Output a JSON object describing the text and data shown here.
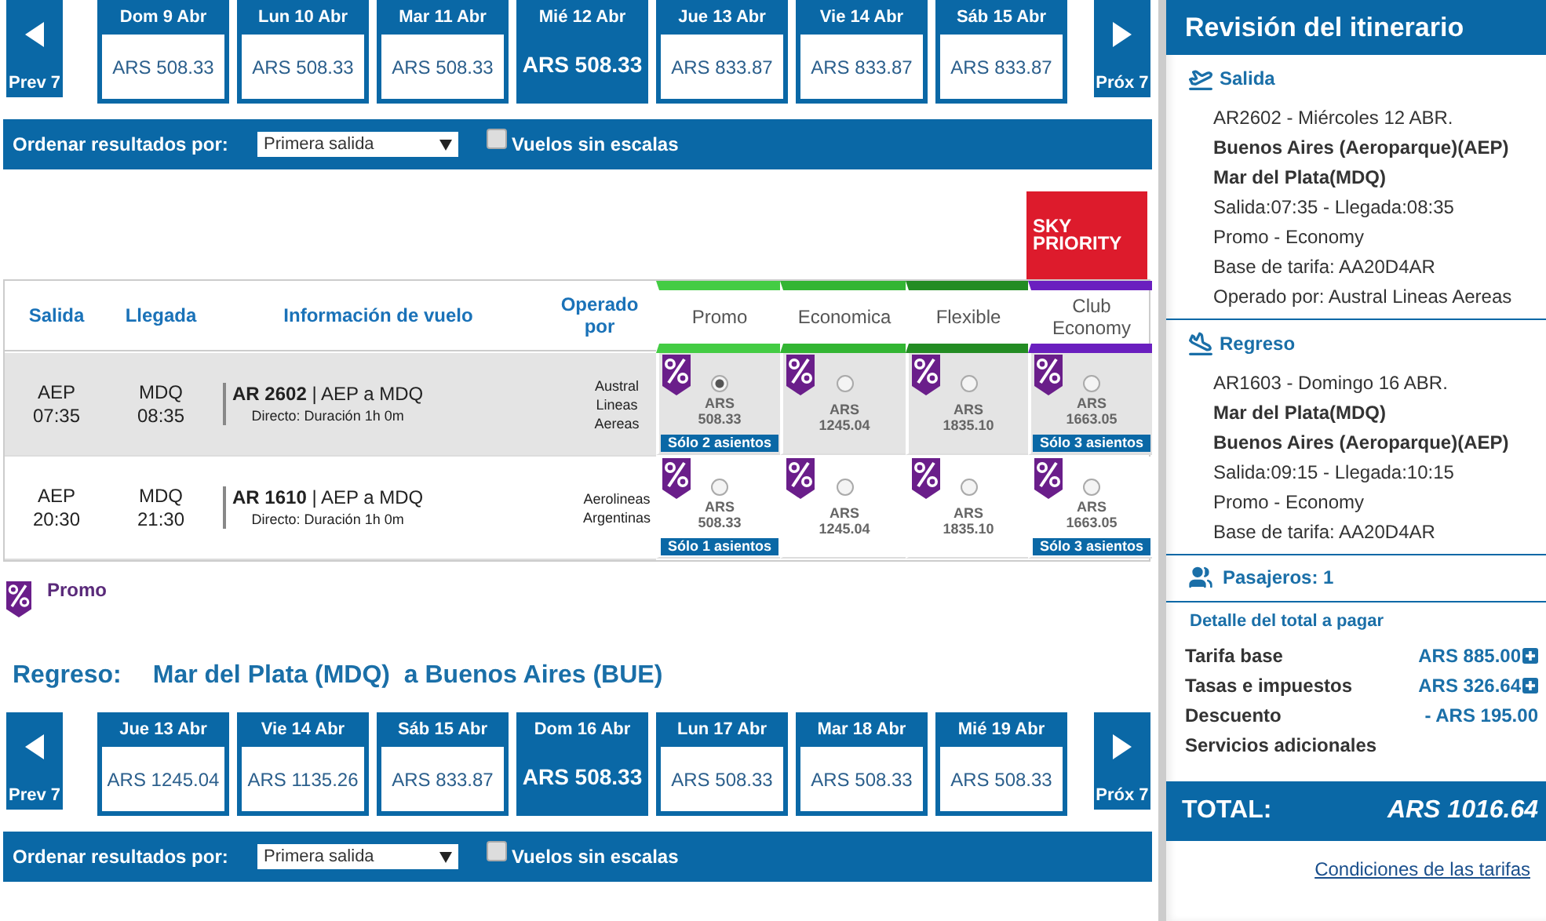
{
  "outbound": {
    "prev": "Prev 7",
    "next": "Próx 7",
    "dates": [
      {
        "day": "Dom 9 Abr",
        "price": "ARS 508.33",
        "selected": false
      },
      {
        "day": "Lun 10 Abr",
        "price": "ARS 508.33",
        "selected": false
      },
      {
        "day": "Mar 11 Abr",
        "price": "ARS 508.33",
        "selected": false
      },
      {
        "day": "Mié 12 Abr",
        "price": "ARS 508.33",
        "selected": true
      },
      {
        "day": "Jue 13 Abr",
        "price": "ARS 833.87",
        "selected": false
      },
      {
        "day": "Vie 14 Abr",
        "price": "ARS 833.87",
        "selected": false
      },
      {
        "day": "Sáb 15 Abr",
        "price": "ARS 833.87",
        "selected": false
      }
    ],
    "sort": {
      "label": "Ordenar resultados por:",
      "value": "Primera salida",
      "checkbox": "Vuelos sin escalas",
      "checked": false
    }
  },
  "fare_table": {
    "logo": [
      "SKY",
      "PRIORITY"
    ],
    "columns": [
      "Salida",
      "Llegada",
      "Información de vuelo",
      "Operado por"
    ],
    "fares": [
      {
        "name": "Promo",
        "color": "#44cc44"
      },
      {
        "name": "Economica",
        "color": "#33b533"
      },
      {
        "name": "Flexible",
        "color": "#238c23"
      },
      {
        "name": "Club Economy",
        "color": "#6a1fbf"
      }
    ],
    "rows": [
      {
        "selected": true,
        "from": "AEP",
        "dep": "07:35",
        "to": "MDQ",
        "arr": "08:35",
        "flight": "AR 2602",
        "route": "| AEP a MDQ",
        "detail": "Directo: Duración 1h 0m",
        "operator": "Austral Lineas Aereas",
        "fares": [
          {
            "currency": "ARS",
            "price": "508.33",
            "seats": "Sólo 2 asientos",
            "selected": true
          },
          {
            "currency": "ARS",
            "price": "1245.04",
            "selected": false
          },
          {
            "currency": "ARS",
            "price": "1835.10",
            "selected": false
          },
          {
            "currency": "ARS",
            "price": "1663.05",
            "seats": "Sólo 3 asientos",
            "selected": false
          }
        ]
      },
      {
        "selected": false,
        "from": "AEP",
        "dep": "20:30",
        "to": "MDQ",
        "arr": "21:30",
        "flight": "AR 1610",
        "route": "| AEP a MDQ",
        "detail": "Directo: Duración 1h 0m",
        "operator": "Aerolineas Argentinas",
        "fares": [
          {
            "currency": "ARS",
            "price": "508.33",
            "seats": "Sólo 1 asientos",
            "selected": false
          },
          {
            "currency": "ARS",
            "price": "1245.04",
            "selected": false
          },
          {
            "currency": "ARS",
            "price": "1835.10",
            "selected": false
          },
          {
            "currency": "ARS",
            "price": "1663.05",
            "seats": "Sólo 3 asientos",
            "selected": false
          }
        ]
      }
    ]
  },
  "legend": {
    "label": "Promo"
  },
  "return_title": {
    "label": "Regreso:",
    "from": "Mar del Plata (MDQ)",
    "to": "a Buenos Aires (BUE)"
  },
  "return": {
    "prev": "Prev 7",
    "next": "Próx 7",
    "dates": [
      {
        "day": "Jue 13 Abr",
        "price": "ARS 1245.04",
        "selected": false
      },
      {
        "day": "Vie 14 Abr",
        "price": "ARS 1135.26",
        "selected": false
      },
      {
        "day": "Sáb 15 Abr",
        "price": "ARS 833.87",
        "selected": false
      },
      {
        "day": "Dom 16 Abr",
        "price": "ARS 508.33",
        "selected": true
      },
      {
        "day": "Lun 17 Abr",
        "price": "ARS 508.33",
        "selected": false
      },
      {
        "day": "Mar 18 Abr",
        "price": "ARS 508.33",
        "selected": false
      },
      {
        "day": "Mié 19 Abr",
        "price": "ARS 508.33",
        "selected": false
      }
    ],
    "sort": {
      "label": "Ordenar resultados por:",
      "value": "Primera salida",
      "checkbox": "Vuelos sin escalas",
      "checked": false
    }
  },
  "sidebar": {
    "title": "Revisión del itinerario",
    "legs": [
      {
        "kind": "takeoff",
        "heading": "Salida",
        "lines": [
          {
            "text": "AR2602 - Miércoles 12 ABR.",
            "bold": false
          },
          {
            "text": "Buenos Aires (Aeroparque)(AEP)",
            "bold": true
          },
          {
            "text": "Mar del Plata(MDQ)",
            "bold": true
          },
          {
            "text": "Salida:07:35 - Llegada:08:35",
            "bold": false
          },
          {
            "text": "Promo - Economy",
            "bold": false
          },
          {
            "text": "Base de tarifa: AA20D4AR",
            "bold": false
          },
          {
            "text": "Operado por: Austral Lineas Aereas",
            "bold": false
          }
        ]
      },
      {
        "kind": "landing",
        "heading": "Regreso",
        "lines": [
          {
            "text": "AR1603 - Domingo 16 ABR.",
            "bold": false
          },
          {
            "text": "Mar del Plata(MDQ)",
            "bold": true
          },
          {
            "text": "Buenos Aires (Aeroparque)(AEP)",
            "bold": true
          },
          {
            "text": "Salida:09:15 - Llegada:10:15",
            "bold": false
          },
          {
            "text": "Promo - Economy",
            "bold": false
          },
          {
            "text": "Base de tarifa: AA20D4AR",
            "bold": false
          }
        ]
      }
    ],
    "passengers": "Pasajeros: 1",
    "detail_title": "Detalle del total a pagar",
    "items": [
      {
        "label": "Tarifa base",
        "amount": "ARS 885.00",
        "expandable": true
      },
      {
        "label": "Tasas e impuestos",
        "amount": "ARS 326.64",
        "expandable": true
      },
      {
        "label": "Descuento",
        "amount": "- ARS 195.00",
        "expandable": false
      },
      {
        "label": "Servicios adicionales"
      }
    ],
    "total_label": "TOTAL:",
    "total": "ARS 1016.64",
    "link": "Condiciones de las tarifas"
  }
}
